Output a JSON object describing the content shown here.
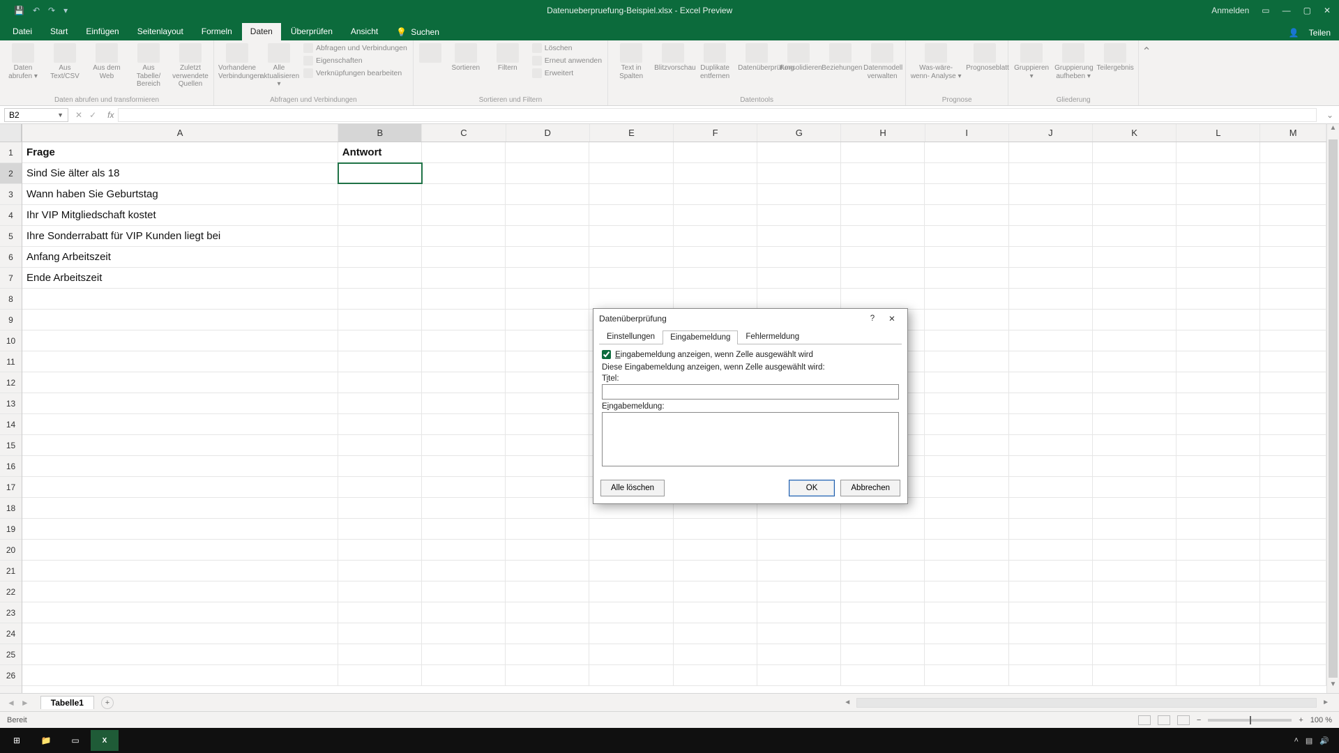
{
  "title": {
    "document": "Datenueberpruefung-Beispiel.xlsx - Excel Preview",
    "account": "Anmelden"
  },
  "menu": {
    "file": "Datei",
    "tabs": [
      "Start",
      "Einfügen",
      "Seitenlayout",
      "Formeln",
      "Daten",
      "Überprüfen",
      "Ansicht"
    ],
    "search": "Suchen",
    "share": "Teilen"
  },
  "ribbon": {
    "group1_label": "Daten abrufen und transformieren",
    "g1_btns": [
      "Daten abrufen ▾",
      "Aus Text/CSV",
      "Aus dem Web",
      "Aus Tabelle/ Bereich",
      "Zuletzt verwendete Quellen"
    ],
    "group2_label": "Abfragen und Verbindungen",
    "g2_a": "Vorhandene Verbindungen",
    "g2_b": "Alle aktualisieren ▾",
    "g2_side": [
      "Abfragen und Verbindungen",
      "Eigenschaften",
      "Verknüpfungen bearbeiten"
    ],
    "group3_label": "Sortieren und Filtern",
    "g3_btns": [
      "Sortieren",
      "Filtern"
    ],
    "g3_side": [
      "Löschen",
      "Erneut anwenden",
      "Erweitert"
    ],
    "group4_label": "Datentools",
    "g4_btns": [
      "Text in Spalten",
      "Blitzvorschau",
      "Duplikate entfernen",
      "Datenüberprüfung",
      "Konsolidieren",
      "Beziehungen",
      "Datenmodell verwalten"
    ],
    "group5_label": "Prognose",
    "g5_btns": [
      "Was-wäre-wenn- Analyse ▾",
      "Prognoseblatt"
    ],
    "group6_label": "Gliederung",
    "g6_btns": [
      "Gruppieren ▾",
      "Gruppierung aufheben ▾",
      "Teilergebnis"
    ]
  },
  "namebox": "B2",
  "columns": [
    "A",
    "B",
    "C",
    "D",
    "E",
    "F",
    "G",
    "H",
    "I",
    "J",
    "K",
    "L",
    "M"
  ],
  "rows": [
    "1",
    "2",
    "3",
    "4",
    "5",
    "6",
    "7",
    "8",
    "9",
    "10",
    "11",
    "12",
    "13",
    "14",
    "15",
    "16",
    "17",
    "18",
    "19",
    "20",
    "21",
    "22",
    "23",
    "24",
    "25",
    "26"
  ],
  "cells": {
    "header_a": "Frage",
    "header_b": "Antwort",
    "a2": "Sind Sie älter als 18",
    "a3": "Wann haben Sie Geburtstag",
    "a4": "Ihr VIP Mitgliedschaft kostet",
    "a5": "Ihre Sonderrabatt für VIP Kunden liegt bei",
    "a6": "Anfang Arbeitszeit",
    "a7": "Ende Arbeitszeit"
  },
  "sheettab": "Tabelle1",
  "status": "Bereit",
  "zoom": "100 %",
  "dialog": {
    "title": "Datenüberprüfung",
    "tabs": [
      "Einstellungen",
      "Eingabemeldung",
      "Fehlermeldung"
    ],
    "checkbox": "Eingabemeldung anzeigen, wenn Zelle ausgewählt wird",
    "heading": "Diese Eingabemeldung anzeigen, wenn Zelle ausgewählt wird:",
    "title_lbl_pre": "T",
    "title_lbl_u": "i",
    "title_lbl_post": "tel:",
    "msg_lbl_pre": "E",
    "msg_lbl_u": "i",
    "msg_lbl_post": "ngabemeldung:",
    "clear": "Alle löschen",
    "ok": "OK",
    "cancel": "Abbrechen"
  }
}
